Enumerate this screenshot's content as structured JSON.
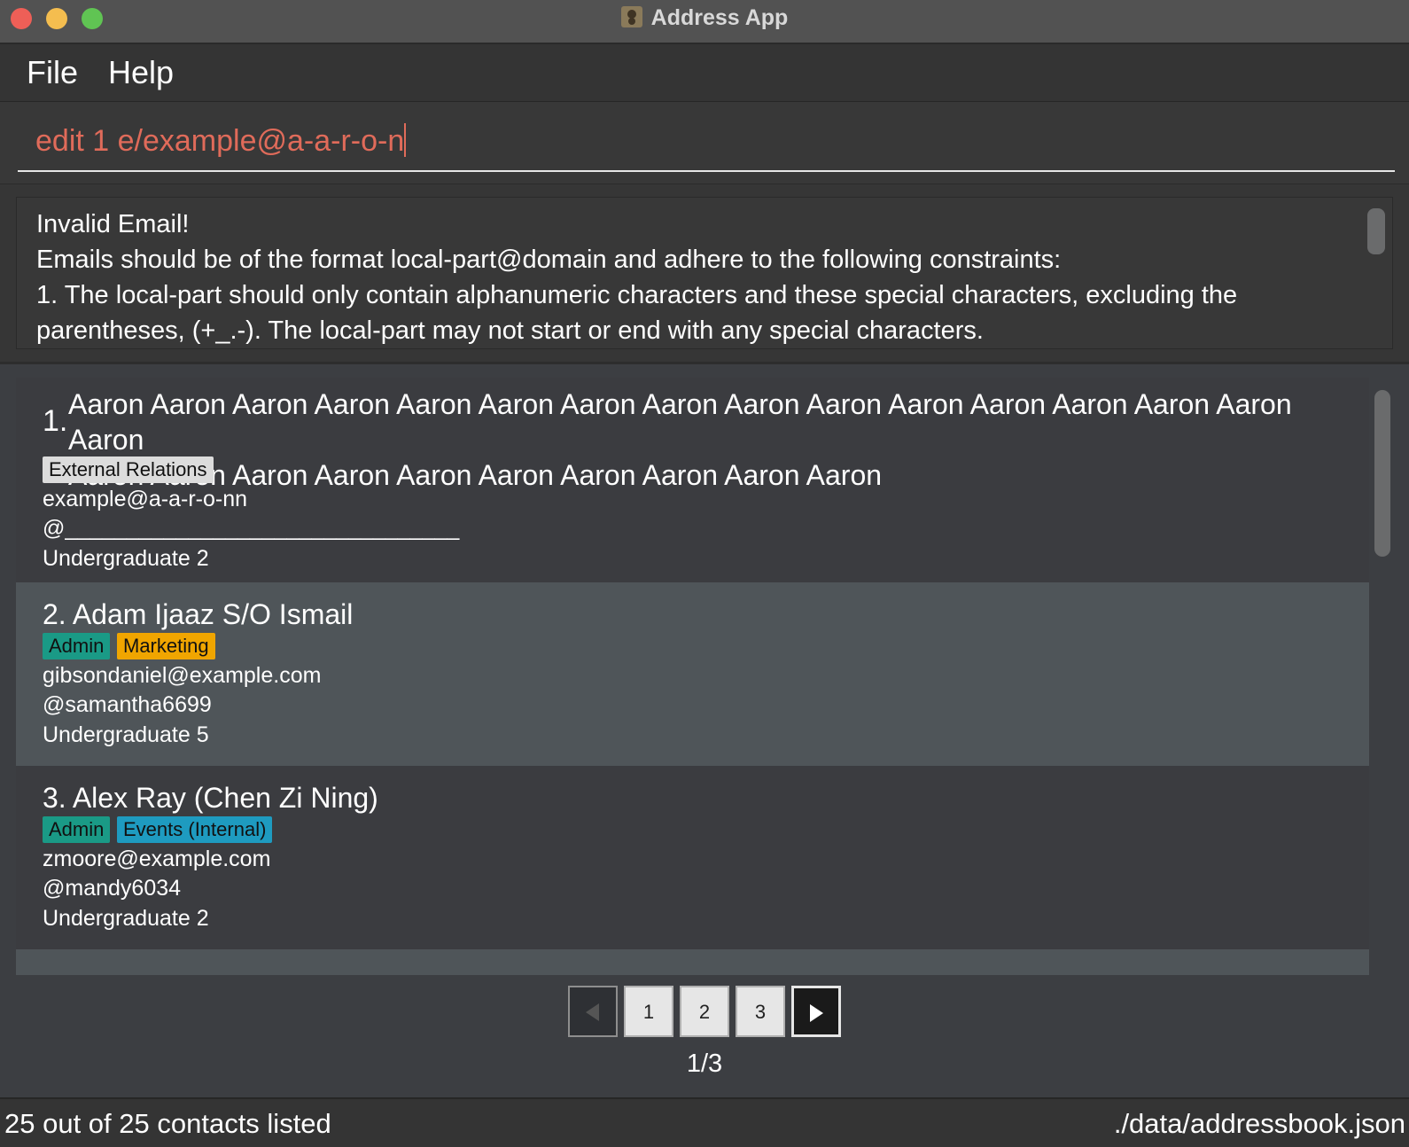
{
  "window": {
    "title": "Address App",
    "icon": "contacts-app-icon"
  },
  "menu": {
    "file": "File",
    "help": "Help"
  },
  "command": {
    "value": "edit 1 e/example@a-a-r-o-n",
    "color": "#e06b5a"
  },
  "result": {
    "line1": "Invalid Email!",
    "line2": "Emails should be of the format local-part@domain and adhere to the following constraints:",
    "line3": "1. The local-part should only contain alphanumeric characters and these special characters, excluding the",
    "line4": "parentheses, (+_.-). The local-part may not start or end with any special characters."
  },
  "contacts": [
    {
      "index": "1.",
      "name_line1": "Aaron Aaron Aaron Aaron Aaron Aaron Aaron Aaron Aaron Aaron Aaron Aaron Aaron Aaron Aaron Aaron",
      "name_line2": "Aaron Aaron Aaron Aaron Aaron Aaron Aaron Aaron Aaron Aaron",
      "tags": [
        "External Relations"
      ],
      "email": "example@a-a-r-o-nn",
      "telegram": "@________________________________",
      "year": "Undergraduate 2"
    },
    {
      "index": "2.",
      "name": "Adam Ijaaz S/O Ismail",
      "tags": [
        "Admin",
        "Marketing"
      ],
      "email": "gibsondaniel@example.com",
      "telegram": "@samantha6699",
      "year": "Undergraduate 5"
    },
    {
      "index": "3.",
      "name": "Alex Ray (Chen Zi Ning)",
      "tags": [
        "Admin",
        "Events (Internal)"
      ],
      "email": "zmoore@example.com",
      "telegram": "@mandy6034",
      "year": "Undergraduate 2"
    }
  ],
  "pagination": {
    "pages": [
      "1",
      "2",
      "3"
    ],
    "prev_icon": "triangle-left-icon",
    "next_icon": "triangle-right-icon",
    "indicator": "1/3"
  },
  "status": {
    "count": "25 out of 25 contacts listed",
    "path": "./data/addressbook.json"
  }
}
